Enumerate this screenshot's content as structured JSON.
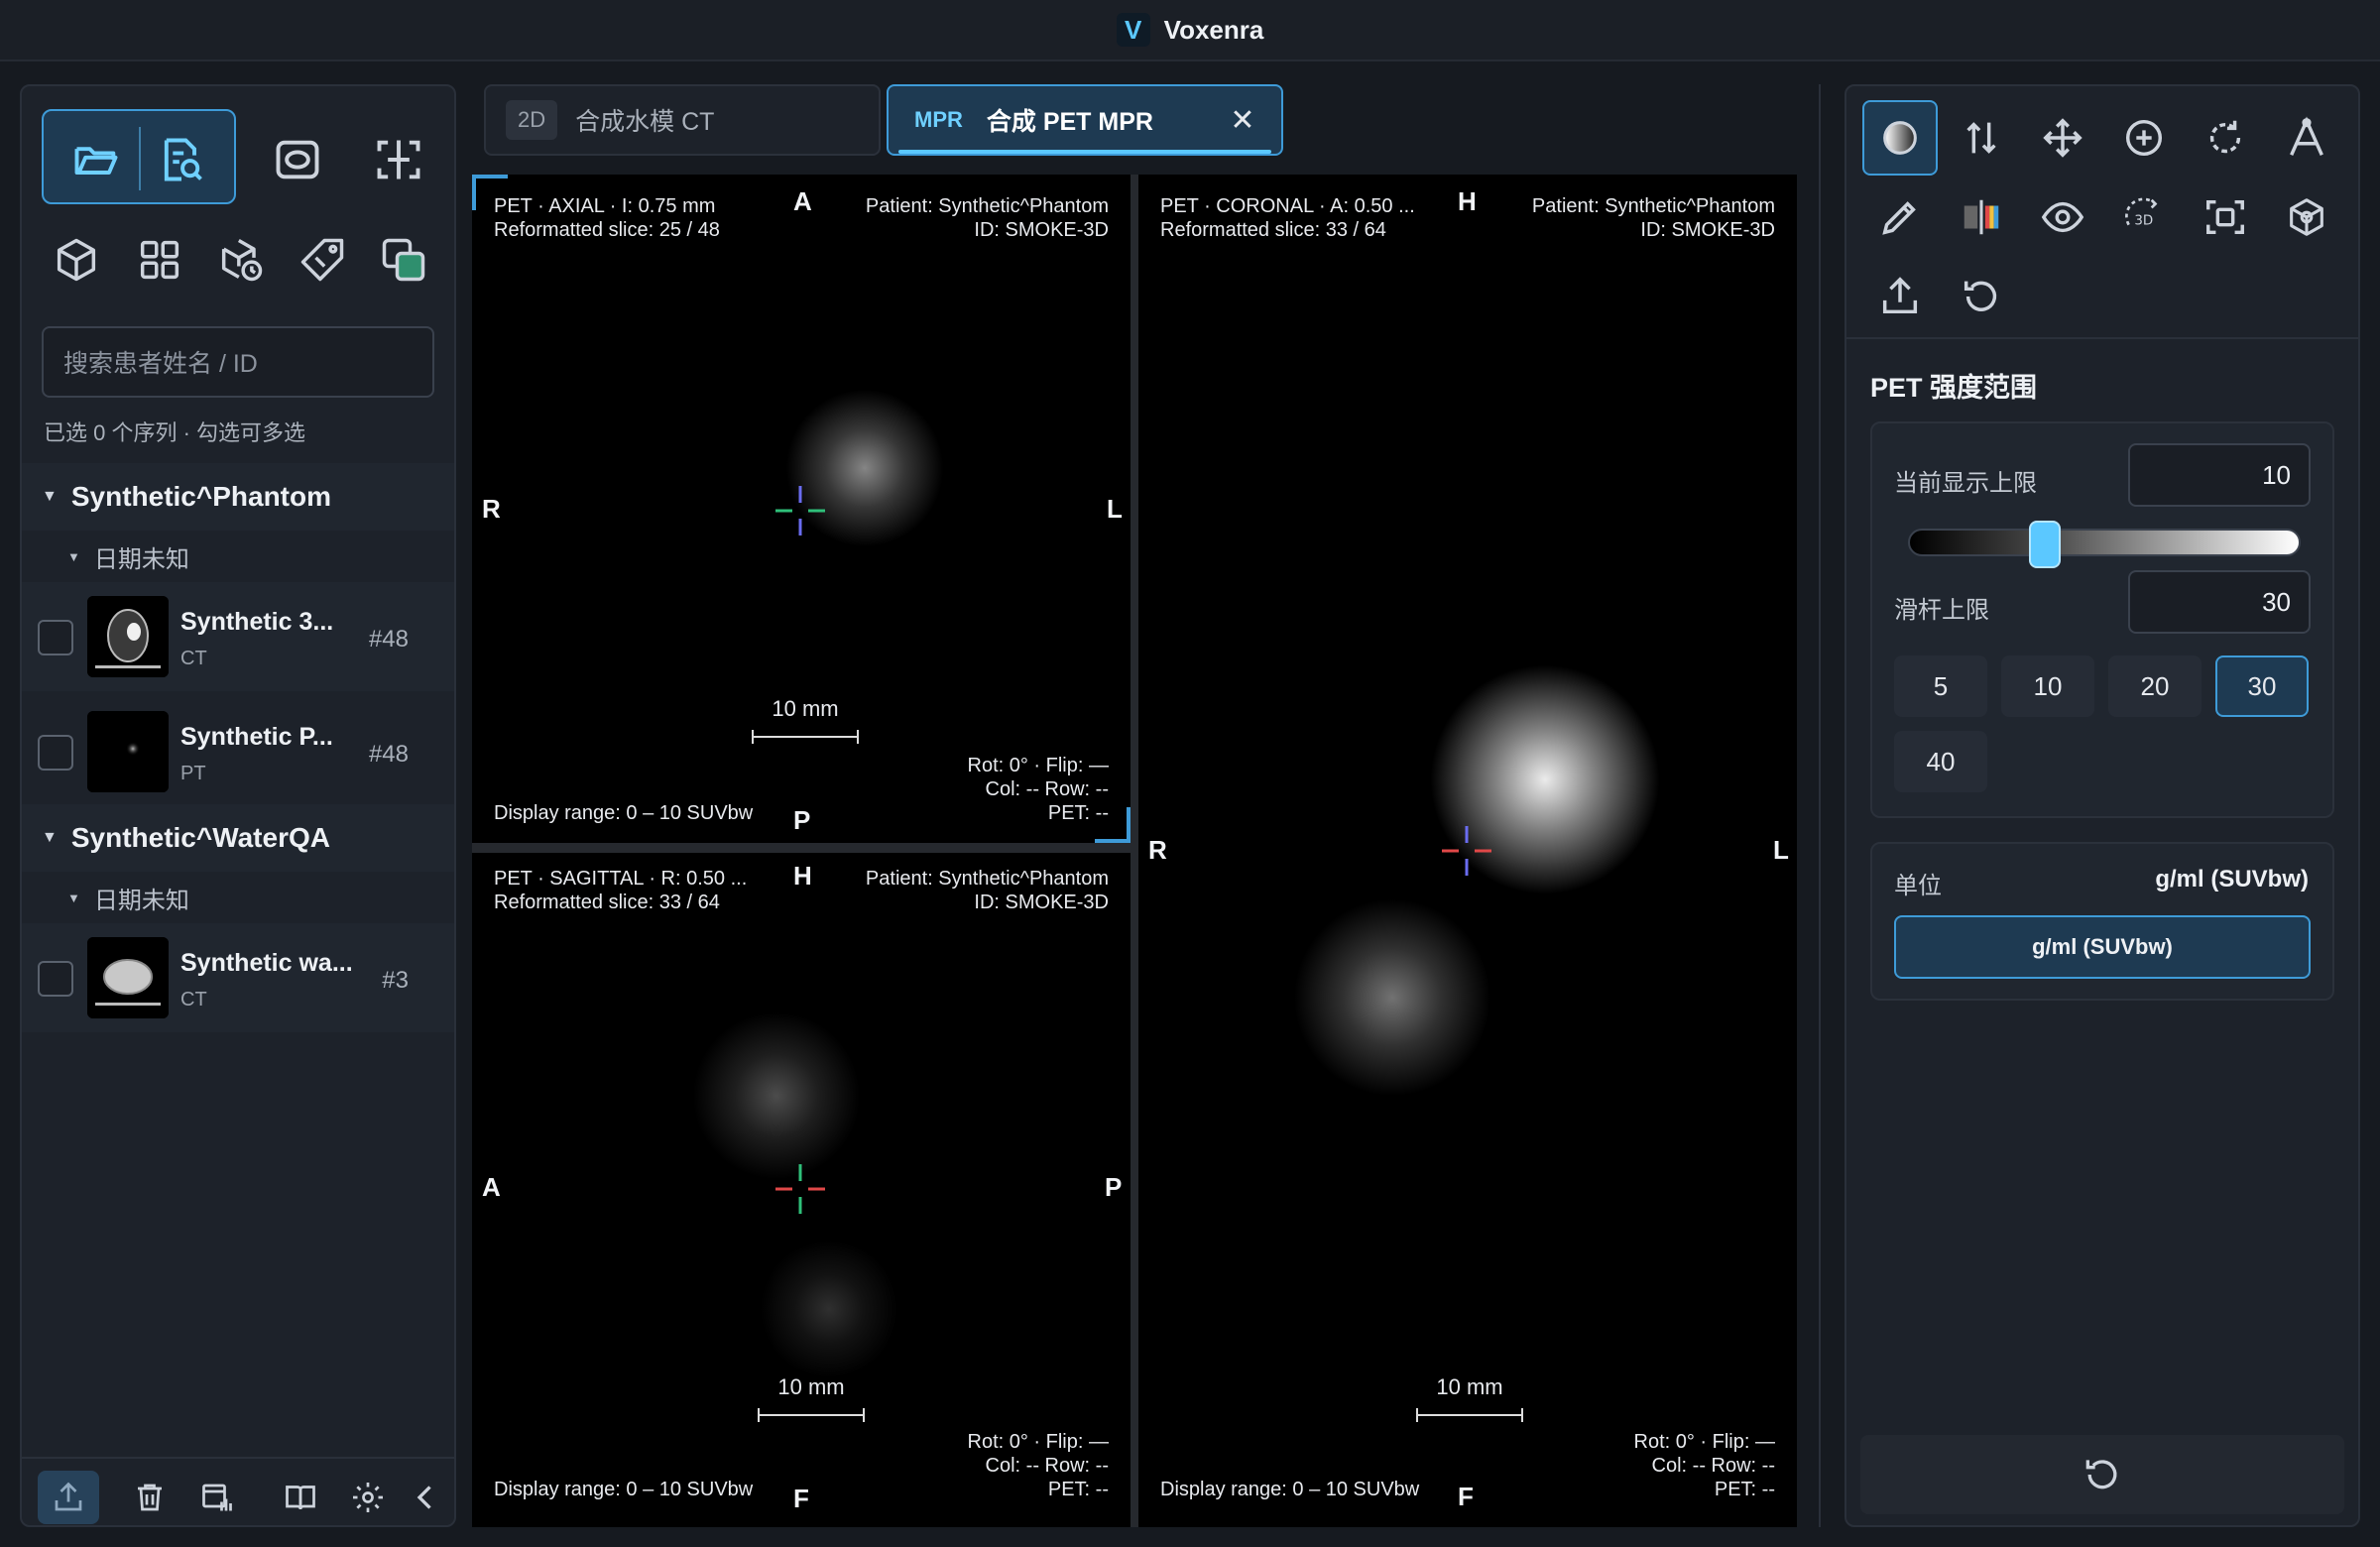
{
  "app": {
    "title": "Voxenra",
    "logo": "V"
  },
  "left_panel": {
    "search_placeholder": "搜索患者姓名 / ID",
    "selection_note": "已选 0 个序列 · 勾选可多选",
    "patients": [
      {
        "name": "Synthetic^Phantom",
        "date": "日期未知",
        "series": [
          {
            "name": "Synthetic 3...",
            "modality": "CT",
            "count": "#48"
          },
          {
            "name": "Synthetic P...",
            "modality": "PT",
            "count": "#48"
          }
        ]
      },
      {
        "name": "Synthetic^WaterQA",
        "date": "日期未知",
        "series": [
          {
            "name": "Synthetic wa...",
            "modality": "CT",
            "count": "#3"
          }
        ]
      }
    ]
  },
  "tabs": [
    {
      "badge": "2D",
      "label": "合成水模 CT",
      "active": false
    },
    {
      "badge": "MPR",
      "label": "合成 PET MPR",
      "active": true
    }
  ],
  "viewports": {
    "axial": {
      "line1": "PET · AXIAL · I: 0.75 mm",
      "line2": "Reformatted slice: 25 / 48",
      "patient": "Patient: Synthetic^Phantom",
      "id": "ID: SMOKE-3D",
      "top": "A",
      "bottom": "P",
      "left": "R",
      "right": "L",
      "scale": "10 mm",
      "rot": "Rot: 0° · Flip: —",
      "colrow": "Col: --   Row: --",
      "pet": "PET: --",
      "range": "Display range: 0 – 10 SUVbw"
    },
    "sagittal": {
      "line1": "PET · SAGITTAL · R: 0.50 ...",
      "line2": "Reformatted slice: 33 / 64",
      "patient": "Patient: Synthetic^Phantom",
      "id": "ID: SMOKE-3D",
      "top": "H",
      "bottom": "F",
      "left": "A",
      "right": "P",
      "scale": "10 mm",
      "rot": "Rot: 0° · Flip: —",
      "colrow": "Col: --   Row: --",
      "pet": "PET: --",
      "range": "Display range: 0 – 10 SUVbw"
    },
    "coronal": {
      "line1": "PET · CORONAL · A: 0.50 ...",
      "line2": "Reformatted slice: 33 / 64",
      "patient": "Patient: Synthetic^Phantom",
      "id": "ID: SMOKE-3D",
      "top": "H",
      "bottom": "F",
      "left": "R",
      "right": "L",
      "scale": "10 mm",
      "rot": "Rot: 0° · Flip: —",
      "colrow": "Col: --   Row: --",
      "pet": "PET: --",
      "range": "Display range: 0 – 10 SUVbw"
    }
  },
  "right_panel": {
    "section_title": "PET 强度范围",
    "current_upper_label": "当前显示上限",
    "current_upper_value": "10",
    "slider_upper_label": "滑杆上限",
    "slider_upper_value": "30",
    "slider_fraction": 0.333,
    "presets": [
      "5",
      "10",
      "20",
      "30",
      "40"
    ],
    "active_preset": "30",
    "unit_label": "单位",
    "unit_value": "g/ml (SUVbw)",
    "unit_button": "g/ml (SUVbw)"
  },
  "colors": {
    "accent": "#3e9bd8",
    "accent_light": "#5bc8ff",
    "panel": "#1d222a",
    "background": "#161a20"
  }
}
